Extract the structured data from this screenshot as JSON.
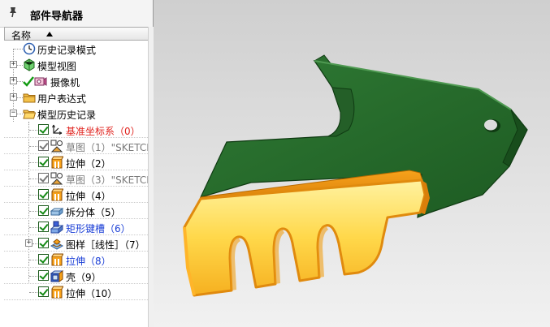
{
  "navigator": {
    "title": "部件导航器",
    "column_header": "名称",
    "items": [
      {
        "label": "历史记录模式",
        "icon": "clock-icon"
      },
      {
        "label": "模型视图",
        "icon": "model-views-icon"
      },
      {
        "label": "摄像机",
        "icon": "camera-icon"
      },
      {
        "label": "用户表达式",
        "icon": "folder-icon"
      },
      {
        "label": "模型历史记录",
        "icon": "folder-open-icon"
      },
      {
        "label": "基准坐标系（0）",
        "icon": "datum-csys-icon"
      },
      {
        "label": "草图（1）\"SKETCH_",
        "icon": "sketch-icon"
      },
      {
        "label": "拉伸（2）",
        "icon": "extrude-icon"
      },
      {
        "label": "草图（3）\"SKETCH_",
        "icon": "sketch-icon"
      },
      {
        "label": "拉伸（4）",
        "icon": "extrude-icon"
      },
      {
        "label": "拆分体（5）",
        "icon": "split-body-icon"
      },
      {
        "label": "矩形键槽（6）",
        "icon": "rectangular-slot-icon"
      },
      {
        "label": "图样［线性］（7）",
        "icon": "pattern-icon"
      },
      {
        "label": "拉伸（8）",
        "icon": "extrude-icon"
      },
      {
        "label": "壳（9）",
        "icon": "shell-icon"
      },
      {
        "label": "拉伸（10）",
        "icon": "extrude-icon"
      }
    ]
  },
  "colors": {
    "model_green": "#2e6b30",
    "model_orange": "#ffd24a",
    "highlight_red": "#e0231e",
    "highlight_blue": "#1b3fd6"
  }
}
